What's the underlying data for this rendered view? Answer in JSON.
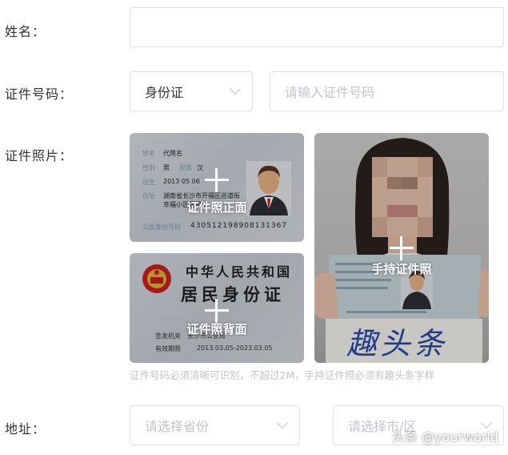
{
  "form": {
    "name_label": "姓名：",
    "name_value": "",
    "id_label": "证件号码：",
    "id_type_selected": "身份证",
    "id_number_placeholder": "请输入证件号码",
    "photo_label": "证件照片：",
    "front_caption": "证件照正面",
    "back_caption": "证件照背面",
    "handheld_caption": "手持证件照",
    "hint": "证件号码必须清晰可识别，不超过2M，手持证件照必须有趣头条字样",
    "address_label": "地址：",
    "province_placeholder": "请选择省份",
    "city_placeholder": "请选择市/区"
  },
  "samples": {
    "front": {
      "name_field": "代用名",
      "sex": "男",
      "ethnicity": "汉",
      "birth": "2013   05   06",
      "address_line1": "湖南省长沙市开福区巡道街",
      "address_line2": "幸福小区居民组",
      "id_number": "430512198908131367",
      "field_labels": [
        "姓名",
        "性别",
        "民族",
        "出生",
        "住址",
        "公民身份号码"
      ]
    },
    "back": {
      "title_line1": "中华人民共和国",
      "title_line2": "居民身份证",
      "authority_label": "签发机关",
      "authority": "长沙市公安局",
      "valid_label": "有效期限",
      "valid_value": "2013.03.05-2023.03.05"
    },
    "handheld": {
      "sign_text": "趣头条"
    }
  },
  "watermark": "头条 @yourworld",
  "colors": {
    "border": "#dcdfe6",
    "placeholder": "#c0c4cc",
    "label": "#333333",
    "emblem_red": "#c8201e"
  },
  "icons": {
    "chevron": "chevron-down-icon",
    "plus": "plus-icon"
  }
}
